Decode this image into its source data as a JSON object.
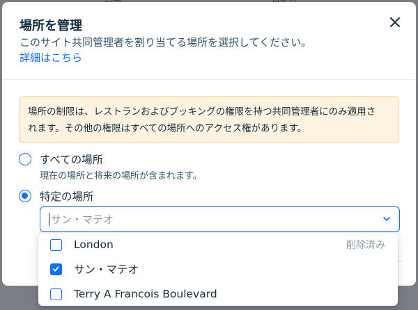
{
  "backdrop": {
    "left_text": "設定",
    "right_text": "最新日"
  },
  "modal": {
    "title": "場所を管理",
    "subtitle": "このサイト共同管理者を割り当てる場所を選択してください。",
    "learn_more": "詳細はこちら",
    "notice": {
      "line1": "場所の制限は、レストランおよびブッキングの権限を持つ共同管理者にのみ適用さ",
      "line2": "れます。その他の権限はすべての場所へのアクセス権があります。"
    },
    "options": {
      "all": {
        "label": "すべての場所",
        "description": "現在の場所と将来の場所が含まれます。",
        "checked": false
      },
      "specific": {
        "label": "特定の場所",
        "checked": true
      }
    },
    "location_select": {
      "placeholder": "サン・マテオ",
      "value": ""
    },
    "dropdown_items": [
      {
        "label": "London",
        "tag": "削除済み",
        "checked": false
      },
      {
        "label": "サン・マテオ",
        "tag": "",
        "checked": true
      },
      {
        "label": "Terry A Francois Boulevard",
        "tag": "",
        "checked": false
      }
    ]
  },
  "colors": {
    "accent": "#116dff",
    "notice_bg": "#fdf3e0",
    "text": "#162d3d",
    "muted": "#8a97a3"
  },
  "icons": {
    "close": "close-icon",
    "chevron": "chevron-down-icon",
    "check": "checkmark-icon"
  }
}
